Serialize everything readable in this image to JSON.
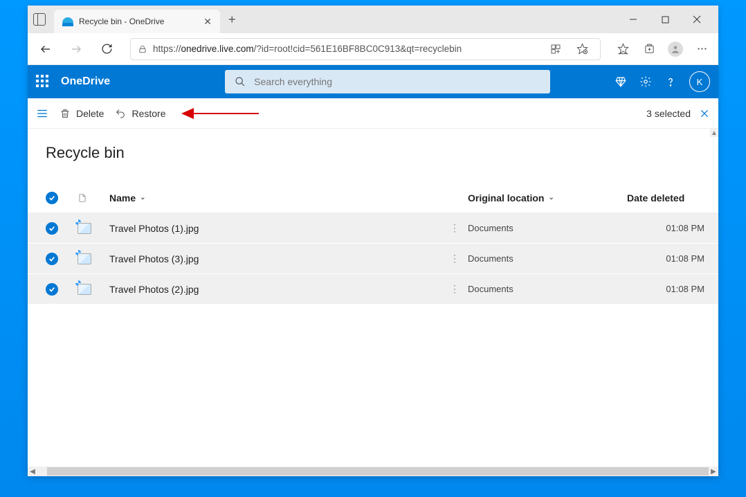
{
  "browser": {
    "tab_title": "Recycle bin - OneDrive",
    "url_prefix": "https://",
    "url_host": "onedrive.live.com",
    "url_path": "/?id=root!cid=561E16BF8BC0C913&qt=recyclebin"
  },
  "onedrive": {
    "app_name": "OneDrive",
    "search_placeholder": "Search everything",
    "avatar_initial": "K"
  },
  "commands": {
    "delete": "Delete",
    "restore": "Restore",
    "selected_count": "3 selected"
  },
  "page": {
    "title": "Recycle bin"
  },
  "columns": {
    "name": "Name",
    "location": "Original location",
    "date": "Date deleted"
  },
  "files": [
    {
      "name": "Travel Photos (1).jpg",
      "location": "Documents",
      "date": "01:08 PM"
    },
    {
      "name": "Travel Photos (3).jpg",
      "location": "Documents",
      "date": "01:08 PM"
    },
    {
      "name": "Travel Photos (2).jpg",
      "location": "Documents",
      "date": "01:08 PM"
    }
  ]
}
